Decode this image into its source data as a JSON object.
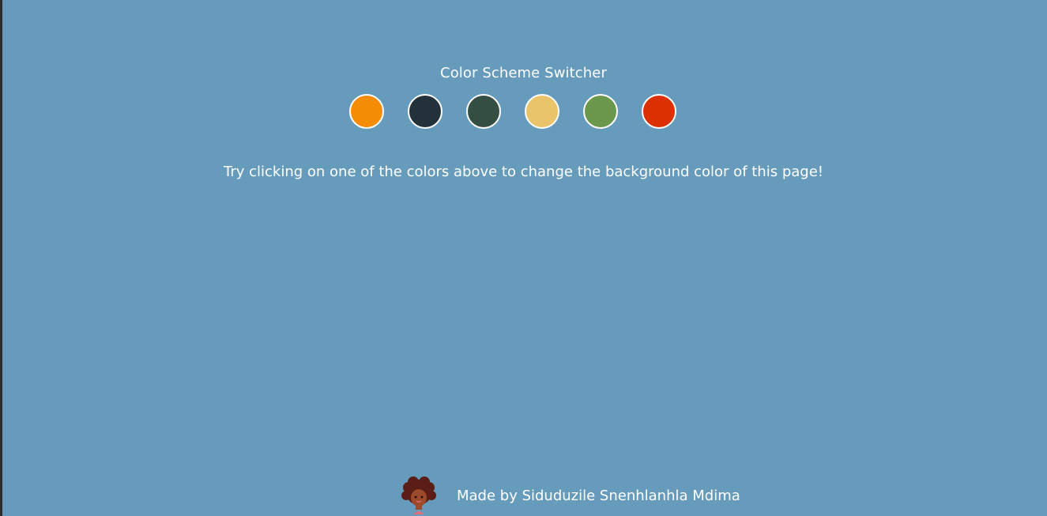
{
  "page": {
    "title": "Color Scheme Switcher",
    "hint": "Try clicking on one of the colors above to change the background color of this page!",
    "background": "#669bbc"
  },
  "swatches": [
    {
      "name": "orange",
      "color": "#f48c06"
    },
    {
      "name": "charcoal",
      "color": "#22313a"
    },
    {
      "name": "dark-green",
      "color": "#344e41"
    },
    {
      "name": "sand",
      "color": "#e9c46a"
    },
    {
      "name": "green",
      "color": "#6a994e"
    },
    {
      "name": "red",
      "color": "#dc2f02"
    }
  ],
  "footer": {
    "credit": "Made by Siduduzile Snenhlanhla Mdima",
    "avatar_icon": "girl-avatar-icon"
  }
}
